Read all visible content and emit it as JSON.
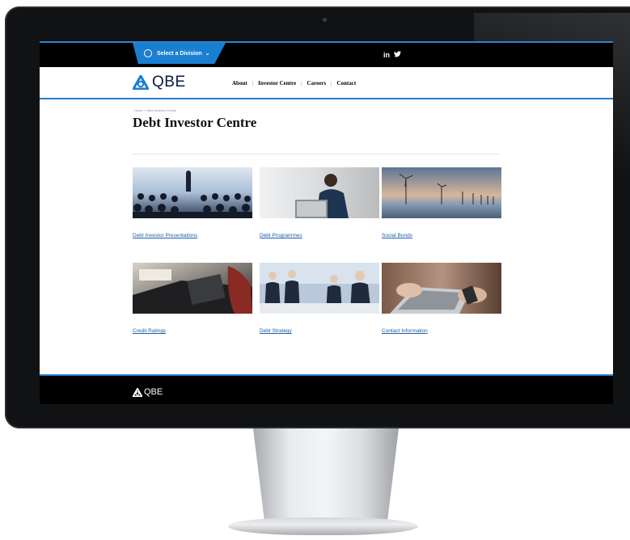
{
  "topbar": {
    "division_label": "Select a Division",
    "social": [
      "in",
      "🐦"
    ]
  },
  "brand": {
    "name": "QBE",
    "accent": "#1b7fd1",
    "link_color": "#1f5da8"
  },
  "nav": {
    "items": [
      "About",
      "Investor Centre",
      "Careers",
      "Contact"
    ]
  },
  "breadcrumb": "Home > Debt Investor Centre",
  "page_title": "Debt Investor Centre",
  "cards": [
    {
      "label": "Debt Investor Presentations",
      "image": "presentation-audience-photo"
    },
    {
      "label": "Debt Programmes",
      "image": "businessman-laptop-photo"
    },
    {
      "label": "Social Bonds",
      "image": "wind-turbines-photo"
    },
    {
      "label": "Credit Ratings",
      "image": "calculator-photo"
    },
    {
      "label": "Debt Strategy",
      "image": "business-meeting-photo"
    },
    {
      "label": "Contact Information",
      "image": "laptop-phone-photo"
    }
  ],
  "footer": {
    "logo_text": "QBE"
  }
}
